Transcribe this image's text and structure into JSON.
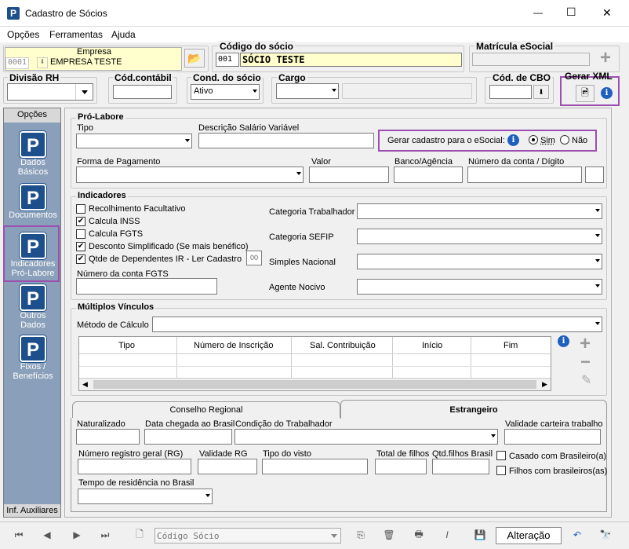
{
  "window": {
    "title": "Cadastro de Sócios",
    "min": "—",
    "max": "☐",
    "close": "✕"
  },
  "menu": [
    "Opções",
    "Ferramentas",
    "Ajuda"
  ],
  "top": {
    "empresa_label": "Empresa",
    "empresa_code": "0001",
    "empresa_name": "EMPRESA TESTE",
    "codigo_label": "Código do sócio",
    "codigo_code": "001",
    "codigo_name": "SÓCIO TESTE",
    "matricula_label": "Matrícula eSocial",
    "plus": "+"
  },
  "row2": {
    "divisao": "Divisão RH",
    "cod_contabil": "Cód.contábil",
    "cond_socio": "Cond. do sócio",
    "cond_value": "Ativo",
    "cargo": "Cargo",
    "cbo": "Cód. de CBO",
    "gerar_xml": "Gerar XML"
  },
  "sidebar": {
    "header": "Opções",
    "items": [
      {
        "l1": "Dados",
        "l2": "Básicos"
      },
      {
        "l1": "Documentos",
        "l2": ""
      },
      {
        "l1": "Indicadores",
        "l2": "Pró-Labore"
      },
      {
        "l1": "Outros",
        "l2": "Dados"
      },
      {
        "l1": "Fixos /",
        "l2": "Benefícios"
      }
    ],
    "footer": "Inf. Auxiliares"
  },
  "prolabore": {
    "title": "Pró-Labore",
    "tipo": "Tipo",
    "descricao": "Descrição Salário Variável",
    "gerar_label": "Gerar cadastro para o eSocial:",
    "sim": "Sim",
    "nao": "Não",
    "forma": "Forma de Pagamento",
    "valor": "Valor",
    "banco": "Banco/Agência",
    "conta": "Número da conta / Dígito"
  },
  "indicadores": {
    "title": "Indicadores",
    "checks": [
      {
        "label": "Recolhimento Facultativo",
        "checked": ""
      },
      {
        "label": "Calcula INSS",
        "checked": "✔"
      },
      {
        "label": "Calcula FGTS",
        "checked": ""
      },
      {
        "label": "Desconto Simplificado (Se mais benéfico)",
        "checked": "✔"
      },
      {
        "label": "Qtde de Dependentes IR - Ler Cadastro",
        "checked": "✔"
      }
    ],
    "qtde_value": "00",
    "conta_fgts": "Número da conta FGTS",
    "categoria_trab": "Categoria Trabalhador",
    "categoria_sefip": "Categoria SEFIP",
    "simples": "Simples Nacional",
    "agente": "Agente Nocivo"
  },
  "multiplos": {
    "title": "Múltiplos Vínculos",
    "metodo": "Método de Cálculo",
    "columns": [
      "Tipo",
      "Número de Inscrição",
      "Sal. Contribuição",
      "Início",
      "Fim"
    ],
    "plus": "+",
    "minus": "−",
    "edit": "✎"
  },
  "tabs": {
    "tab1": "Conselho Regional",
    "tab2": "Estrangeiro",
    "naturalizado": "Naturalizado",
    "data_chegada": "Data chegada ao Brasil",
    "condicao": "Condição do Trabalhador",
    "validade_carteira": "Validade carteira trabalho",
    "rg": "Número registro geral (RG)",
    "validade_rg": "Validade RG",
    "tipo_visto": "Tipo do visto",
    "total_filhos": "Total de filhos",
    "qtd_filhos": "Qtd.filhos Brasil",
    "casado": "Casado com Brasileiro(a)",
    "filhos_br": "Filhos com brasileiros(as)",
    "tempo": "Tempo de residência no Brasil"
  },
  "bottom": {
    "search_placeholder": "Código Sócio",
    "mode": "Alteração"
  }
}
